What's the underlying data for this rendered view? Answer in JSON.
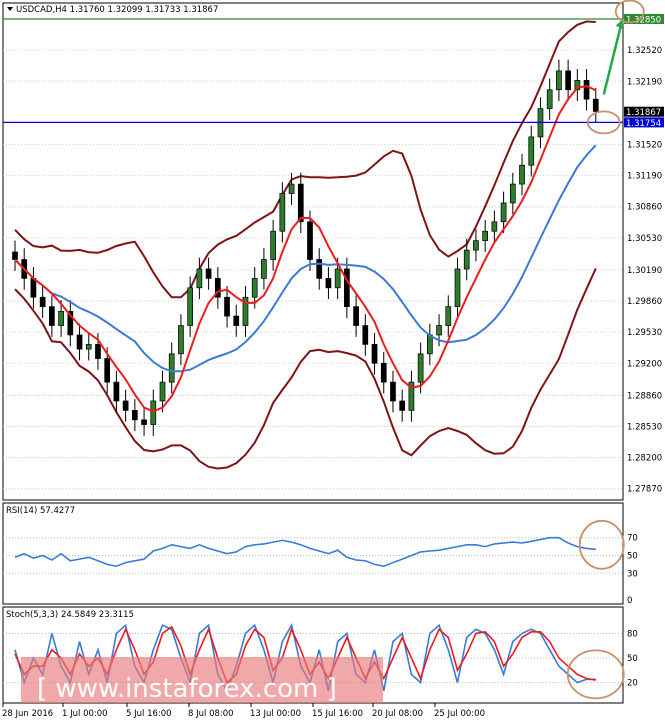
{
  "chart_data": [
    {
      "type": "candlestick",
      "header": "USDCAD,H4  1.31760 1.32099 1.31733 1.31867",
      "y_ticks": [
        "1.32520",
        "1.32190",
        "1.31520",
        "1.31190",
        "1.30860",
        "1.30530",
        "1.30190",
        "1.29860",
        "1.29530",
        "1.29200",
        "1.28860",
        "1.28530",
        "1.28200",
        "1.27870"
      ],
      "y_ticks_visible_only": true,
      "ylim": [
        1.2775,
        1.3302
      ],
      "price_labels": [
        {
          "label": "1.32850",
          "value": 1.3285,
          "color": "#2e8b2e"
        },
        {
          "label": "1.31867",
          "value": 1.31867,
          "color": "#000000"
        },
        {
          "label": "1.31754",
          "value": 1.31754,
          "color": "#0000dd"
        }
      ],
      "x_labels": [
        "28 Jun 2016",
        "1 Jul 00:00",
        "5 Jul 16:00",
        "8 Jul 08:00",
        "13 Jul 00:00",
        "15 Jul 16:00",
        "20 Jul 08:00",
        "25 Jul 00:00"
      ],
      "close": [
        1.303,
        1.301,
        1.299,
        1.298,
        1.296,
        1.2975,
        1.295,
        1.2935,
        1.294,
        1.2925,
        1.29,
        1.288,
        1.287,
        1.286,
        1.2855,
        1.288,
        1.29,
        1.293,
        1.296,
        1.3,
        1.302,
        1.301,
        1.299,
        1.297,
        1.296,
        1.299,
        1.301,
        1.303,
        1.306,
        1.31,
        1.311,
        1.307,
        1.303,
        1.301,
        1.3,
        1.302,
        1.298,
        1.296,
        1.294,
        1.292,
        1.29,
        1.288,
        1.287,
        1.29,
        1.293,
        1.295,
        1.296,
        1.298,
        1.302,
        1.304,
        1.305,
        1.306,
        1.307,
        1.309,
        1.311,
        1.313,
        1.316,
        1.319,
        1.321,
        1.323,
        1.321,
        1.322,
        1.32,
        1.3187
      ],
      "candle_color": "#2e7d2e",
      "overlays": [
        {
          "kind": "line",
          "color": "#ee1c1c",
          "period": 5
        },
        {
          "kind": "line",
          "color": "#3a7bd5",
          "period": 14
        },
        {
          "kind": "bands",
          "color": "#7f1416",
          "period": 14,
          "k": 2.1
        }
      ],
      "arrow_color": "#22aa44",
      "circle_color": "#c8906a"
    },
    {
      "type": "line",
      "header": "RSI(14) 57.4277",
      "y_ticks": [
        "70",
        "50",
        "30",
        "0"
      ],
      "ylim": [
        0,
        100
      ],
      "values": [
        48,
        52,
        47,
        50,
        45,
        52,
        44,
        46,
        48,
        44,
        40,
        38,
        42,
        44,
        46,
        55,
        58,
        62,
        60,
        58,
        62,
        58,
        55,
        52,
        54,
        60,
        62,
        63,
        65,
        67,
        65,
        62,
        58,
        55,
        52,
        56,
        48,
        45,
        44,
        40,
        38,
        42,
        46,
        50,
        54,
        55,
        56,
        58,
        60,
        62,
        62,
        60,
        63,
        64,
        65,
        64,
        66,
        68,
        70,
        70,
        64,
        60,
        58,
        57
      ],
      "color": "#3a7bd5"
    },
    {
      "type": "line",
      "header": "Stoch(5,3,3) 24.5849 23.3115",
      "y_ticks": [
        "80",
        "50",
        "20"
      ],
      "ylim": [
        0,
        100
      ],
      "series": [
        {
          "values": [
            60,
            20,
            50,
            30,
            80,
            40,
            20,
            70,
            30,
            60,
            20,
            80,
            90,
            40,
            20,
            60,
            90,
            85,
            50,
            20,
            80,
            90,
            30,
            10,
            40,
            80,
            90,
            60,
            20,
            70,
            90,
            40,
            20,
            60,
            10,
            70,
            80,
            30,
            20,
            60,
            10,
            70,
            80,
            30,
            20,
            80,
            90,
            60,
            20,
            75,
            85,
            80,
            60,
            30,
            70,
            80,
            85,
            80,
            60,
            40,
            30,
            20,
            24,
            24
          ],
          "color": "#3a7bd5"
        },
        {
          "values": [
            55,
            30,
            40,
            40,
            60,
            50,
            30,
            55,
            40,
            50,
            30,
            60,
            85,
            60,
            30,
            45,
            80,
            88,
            65,
            30,
            60,
            85,
            50,
            20,
            30,
            65,
            85,
            75,
            35,
            50,
            85,
            60,
            30,
            45,
            25,
            50,
            75,
            50,
            25,
            45,
            25,
            50,
            75,
            50,
            25,
            60,
            85,
            75,
            35,
            55,
            80,
            82,
            70,
            40,
            55,
            75,
            82,
            82,
            70,
            50,
            40,
            30,
            25,
            23
          ],
          "color": "#ee1c1c"
        }
      ],
      "circle_color": "#c8906a"
    }
  ],
  "watermark": "[ www.instaforex.com ]"
}
